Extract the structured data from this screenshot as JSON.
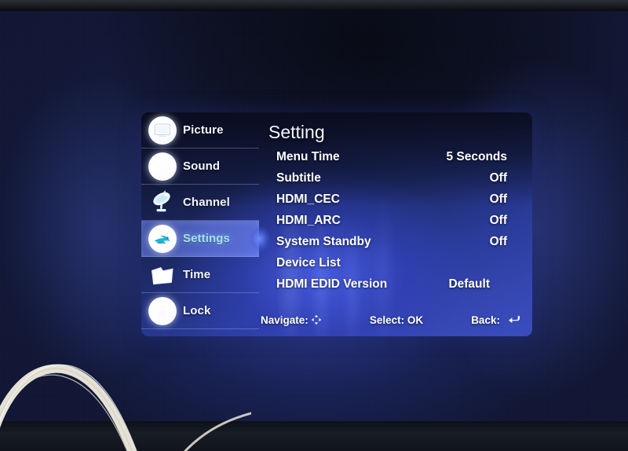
{
  "device": {
    "screen_label": "TV on-screen display menu",
    "accent_highlight": "#6b81e8",
    "active_text_color": "#a9ddf6",
    "text_color": "#ffffff",
    "panel_blue": "#3648b4"
  },
  "osd": {
    "title": "Setting",
    "sidebar": {
      "items": [
        {
          "label": "Picture",
          "icon": "television-icon",
          "active": false
        },
        {
          "label": "Sound",
          "icon": "speaker-icon",
          "active": false
        },
        {
          "label": "Channel",
          "icon": "satellite-dish-icon",
          "active": false
        },
        {
          "label": "Settings",
          "icon": "settings-swoosh-icon",
          "active": true
        },
        {
          "label": "Time",
          "icon": "folder-clock-icon",
          "active": false
        },
        {
          "label": "Lock",
          "icon": "lock-icon",
          "active": false
        }
      ]
    },
    "rows": [
      {
        "label": "Menu Time",
        "value": "5 Seconds"
      },
      {
        "label": "Subtitle",
        "value": "Off"
      },
      {
        "label": "HDMI_CEC",
        "value": "Off"
      },
      {
        "label": "HDMI_ARC",
        "value": "Off"
      },
      {
        "label": "System Standby",
        "value": "Off"
      },
      {
        "label": "Device List",
        "value": ""
      },
      {
        "label": "HDMI EDID Version",
        "value": "Default"
      }
    ],
    "footer": {
      "navigate_label": "Navigate:",
      "navigate_icon": "dpad-four-arrows-icon",
      "select_label": "Select: OK",
      "back_label": "Back:",
      "back_icon": "return-arrow-icon"
    }
  }
}
